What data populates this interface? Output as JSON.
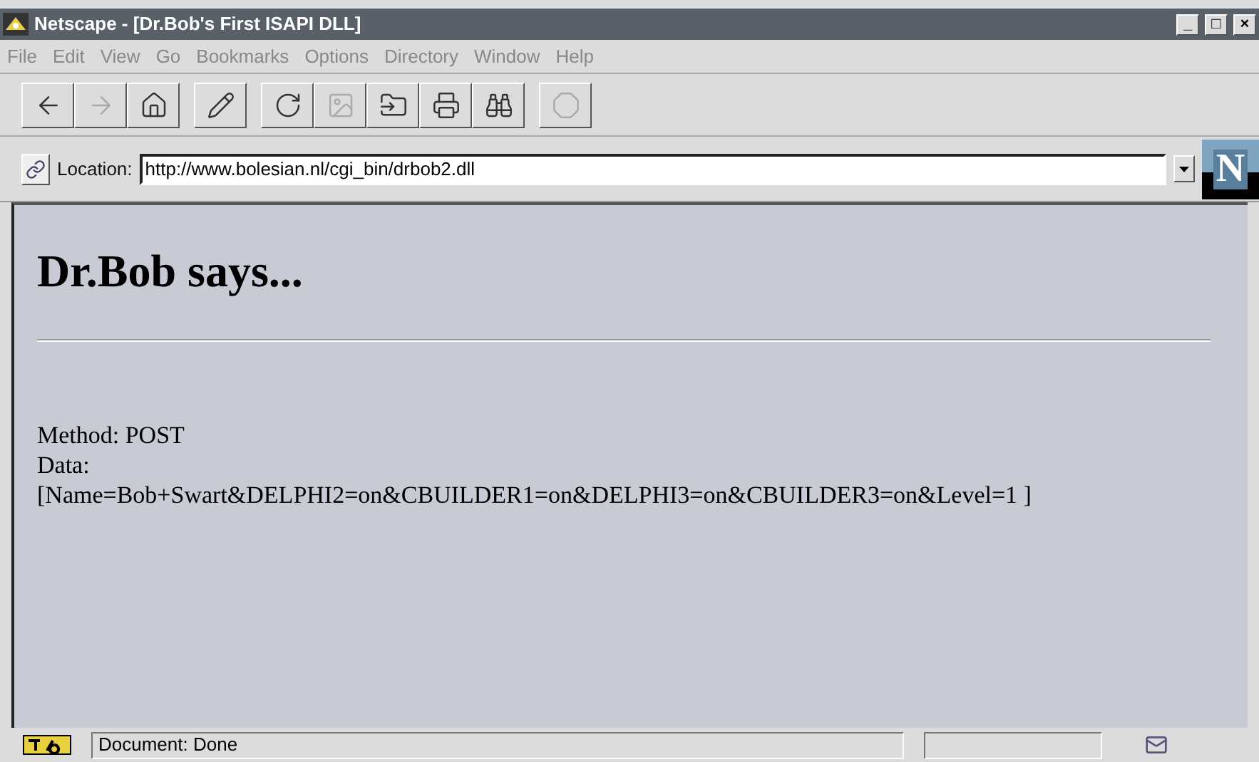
{
  "window": {
    "title": "Netscape - [Dr.Bob's First ISAPI DLL]",
    "controls": [
      "_",
      "□",
      "×"
    ]
  },
  "menu": [
    "File",
    "Edit",
    "View",
    "Go",
    "Bookmarks",
    "Options",
    "Directory",
    "Window",
    "Help"
  ],
  "toolbar": [
    {
      "kind": "back",
      "disabled": false
    },
    {
      "kind": "forward",
      "disabled": true
    },
    {
      "kind": "home",
      "disabled": false
    },
    {
      "kind": "edit",
      "disabled": false,
      "gap": true
    },
    {
      "kind": "reload",
      "disabled": false,
      "gap": true
    },
    {
      "kind": "images",
      "disabled": true
    },
    {
      "kind": "open",
      "disabled": false
    },
    {
      "kind": "print",
      "disabled": false
    },
    {
      "kind": "find",
      "disabled": false
    },
    {
      "kind": "stop",
      "disabled": true,
      "gap": true
    }
  ],
  "location": {
    "label": "Location:",
    "value": "http://www.bolesian.nl/cgi_bin/drbob2.dll"
  },
  "logo": "N",
  "page": {
    "heading": "Dr.Bob says...",
    "lines": [
      "Method: POST",
      "Data:",
      "[Name=Bob+Swart&DELPHI2=on&CBUILDER1=on&DELPHI3=on&CBUILDER3=on&Level=1 ]"
    ]
  },
  "status_bar": {
    "text": "Document: Done"
  }
}
